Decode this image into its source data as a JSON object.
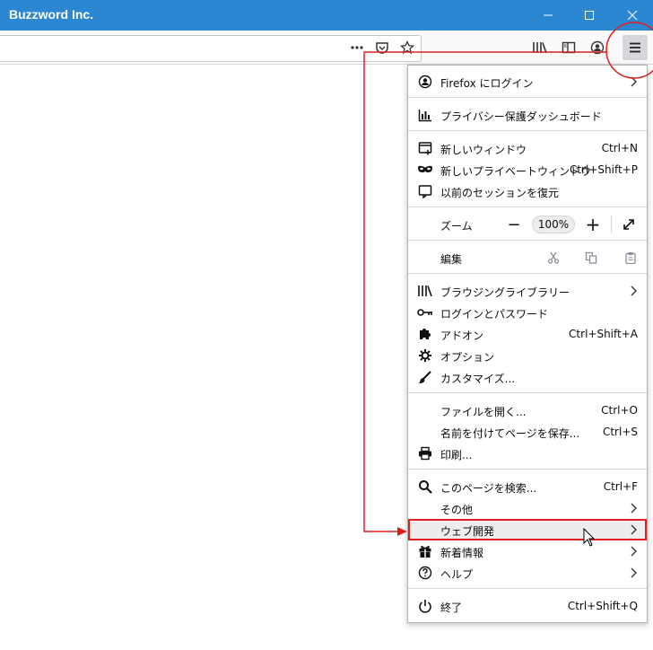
{
  "window": {
    "title": "Buzzword Inc."
  },
  "toolbar": {
    "icons": [
      "more-dots-icon",
      "pocket-icon",
      "bookmark-star-icon",
      "library-icon",
      "sidebar-icon",
      "account-icon",
      "hamburger-menu-icon"
    ]
  },
  "menu": {
    "firefox_login": "Firefox にログイン",
    "privacy_dashboard": "プライバシー保護ダッシュボード",
    "new_window": {
      "label": "新しいウィンドウ",
      "shortcut": "Ctrl+N"
    },
    "new_private_window": {
      "label": "新しいプライベートウィンドウ",
      "shortcut": "Ctrl+Shift+P"
    },
    "restore_session": "以前のセッションを復元",
    "zoom": {
      "label": "ズーム",
      "minus": "−",
      "value": "100%",
      "plus": "+"
    },
    "edit": {
      "label": "編集"
    },
    "library": "ブラウジングライブラリー",
    "logins": "ログインとパスワード",
    "addons": {
      "label": "アドオン",
      "shortcut": "Ctrl+Shift+A"
    },
    "options": "オプション",
    "customize": "カスタマイズ...",
    "open_file": {
      "label": "ファイルを開く...",
      "shortcut": "Ctrl+O"
    },
    "save_page": {
      "label": "名前を付けてページを保存...",
      "shortcut": "Ctrl+S"
    },
    "print": "印刷...",
    "find": {
      "label": "このページを検索...",
      "shortcut": "Ctrl+F"
    },
    "more": "その他",
    "web_developer": "ウェブ開発",
    "whats_new": "新着情報",
    "help": "ヘルプ",
    "exit": {
      "label": "終了",
      "shortcut": "Ctrl+Shift+Q"
    }
  },
  "colors": {
    "titlebar": "#2b87d1",
    "annotation": "#e02020",
    "panel_border": "#b1b1b3"
  }
}
